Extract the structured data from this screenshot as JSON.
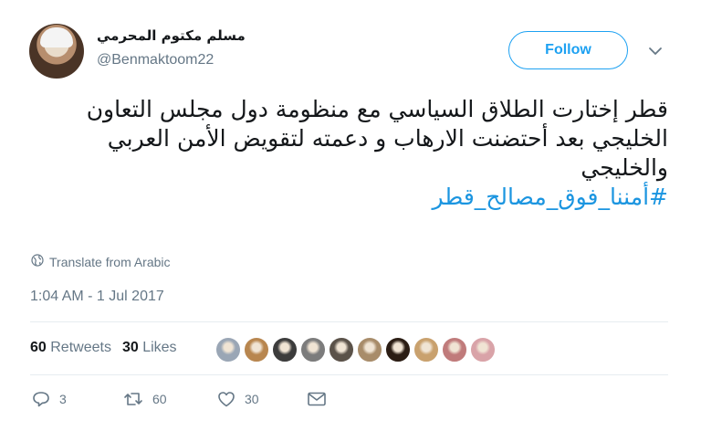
{
  "user": {
    "display_name": "مسلم مكتوم المحرمي",
    "handle": "@Benmaktoom22"
  },
  "follow_button": {
    "label": "Follow"
  },
  "tweet": {
    "lines": [
      "قطر إختارت الطلاق السياسي مع منظومة دول مجلس التعاون",
      "الخليجي بعد أحتضنت الارهاب و دعمته لتقويض الأمن العربي",
      "والخليجي"
    ],
    "hashtag": "#أمننا_فوق_مصالح_قطر"
  },
  "translate_label": "Translate from Arabic",
  "timestamp": "1:04 AM - 1 Jul 2017",
  "stats": {
    "retweets_count": "60",
    "retweets_label": "Retweets",
    "likes_count": "30",
    "likes_label": "Likes"
  },
  "likers": [
    {
      "color": "#9aa6b5"
    },
    {
      "color": "#b8864f"
    },
    {
      "color": "#3c3c3c"
    },
    {
      "color": "#7c7c7c"
    },
    {
      "color": "#5b5249"
    },
    {
      "color": "#a88c6a"
    },
    {
      "color": "#2b1d14"
    },
    {
      "color": "#c9a16e"
    },
    {
      "color": "#c07b7b"
    },
    {
      "color": "#d9a3a8"
    }
  ],
  "actions": {
    "reply_count": "3",
    "retweet_count": "60",
    "like_count": "30"
  },
  "icons": {
    "reply": "reply-icon",
    "retweet": "retweet-icon",
    "like": "heart-icon",
    "dm": "envelope-icon",
    "globe": "globe-icon",
    "chevron": "chevron-down-icon"
  },
  "colors": {
    "accent": "#1da1f2",
    "hashtag": "#1b95e0",
    "muted": "#657786",
    "text": "#14171a"
  }
}
